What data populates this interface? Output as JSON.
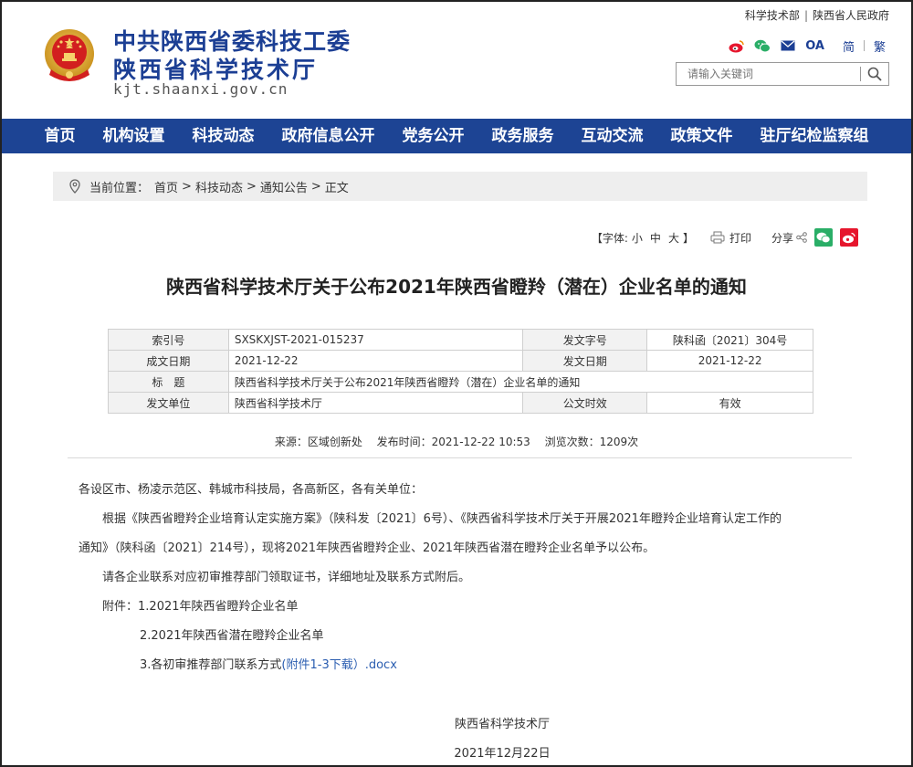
{
  "header": {
    "org_line1": "中共陕西省委科技工委",
    "org_line2": "陕西省科学技术厅",
    "domain": "kjt.shaanxi.gov.cn",
    "top_links": [
      "科学技术部",
      "陕西省人民政府"
    ],
    "top_sep": "|",
    "lang_simplified": "简",
    "lang_traditional": "繁",
    "oa_label": "OA",
    "search_placeholder": "请输入关键词",
    "colors": {
      "brand_blue": "#1c3f94",
      "weibo": "#e6162d",
      "wechat": "#2aae67"
    }
  },
  "nav": {
    "items": [
      "首页",
      "机构设置",
      "科技动态",
      "政府信息公开",
      "党务公开",
      "政务服务",
      "互动交流",
      "政策文件",
      "驻厅纪检监察组"
    ]
  },
  "breadcrumb": {
    "label": "当前位置：",
    "items": [
      "首页",
      "科技动态",
      "通知公告",
      "正文"
    ],
    "sep": ">"
  },
  "tools": {
    "font_label": "【字体:",
    "font_small": "小",
    "font_mid": "中",
    "font_large": "大",
    "font_close": "】",
    "print": "打印",
    "share": "分享"
  },
  "article": {
    "title": "陕西省科学技术厅关于公布2021年陕西省瞪羚（潜在）企业名单的通知",
    "meta": {
      "index_key": "索引号",
      "index_val": "SXSKXJST-2021-015237",
      "docno_key": "发文字号",
      "docno_val": "陕科函〔2021〕304号",
      "created_key": "成文日期",
      "created_val": "2021-12-22",
      "issued_key": "发文日期",
      "issued_val": "2021-12-22",
      "title_key": "标　题",
      "title_val": "陕西省科学技术厅关于公布2021年陕西省瞪羚（潜在）企业名单的通知",
      "unit_key": "发文单位",
      "unit_val": "陕西省科学技术厅",
      "valid_key": "公文时效",
      "valid_val": "有效"
    },
    "source": "来源：区域创新处",
    "publish_time": "发布时间：2021-12-22 10:53",
    "views": "浏览次数：1209次",
    "salutation": "各设区市、杨凌示范区、韩城市科技局，各高新区，各有关单位：",
    "para1_line1": "根据《陕西省瞪羚企业培育认定实施方案》（陕科发〔2021〕6号）、《陕西省科学技术厅关于开展2021年瞪羚企业培育认定工作的",
    "para1_line2": "通知》（陕科函〔2021〕214号），现将2021年陕西省瞪羚企业、2021年陕西省潜在瞪羚企业名单予以公布。",
    "para2": "请各企业联系对应初审推荐部门领取证书，详细地址及联系方式附后。",
    "attach_label": "附件：",
    "attach1": "1.2021年陕西省瞪羚企业名单",
    "attach2": "2.2021年陕西省潜在瞪羚企业名单",
    "attach3_text": "3.各初审推荐部门联系方式",
    "attach3_link": "(附件1-3下载）.docx",
    "signature": "陕西省科学技术厅",
    "sign_date": "2021年12月22日"
  }
}
